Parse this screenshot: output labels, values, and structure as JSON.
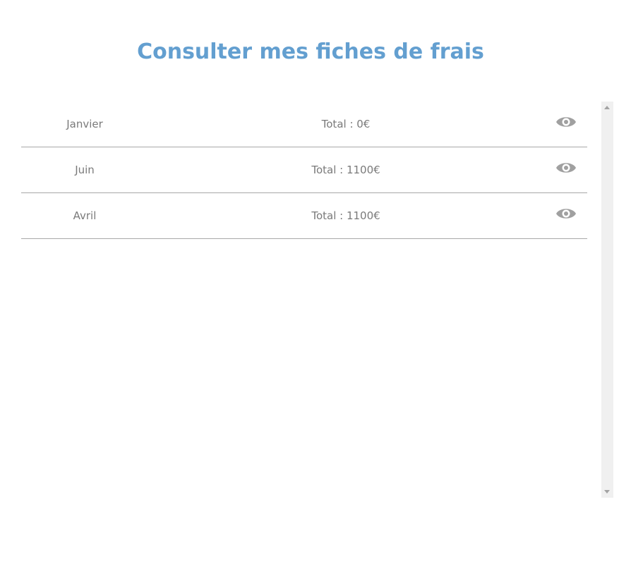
{
  "page": {
    "title": "Consulter mes fiches de frais"
  },
  "fiches": [
    {
      "month": "Janvier",
      "total": "Total : 0€",
      "action_icon": "eye-icon"
    },
    {
      "month": "Juin",
      "total": "Total : 1100€",
      "action_icon": "eye-icon"
    },
    {
      "month": "Avril",
      "total": "Total : 1100€",
      "action_icon": "eye-icon"
    }
  ],
  "colors": {
    "title": "#639fd0",
    "text": "#7a7a7a",
    "icon": "#a0a0a0",
    "divider": "#a8a8a8",
    "scrollbar_track": "#f0f0f0"
  }
}
